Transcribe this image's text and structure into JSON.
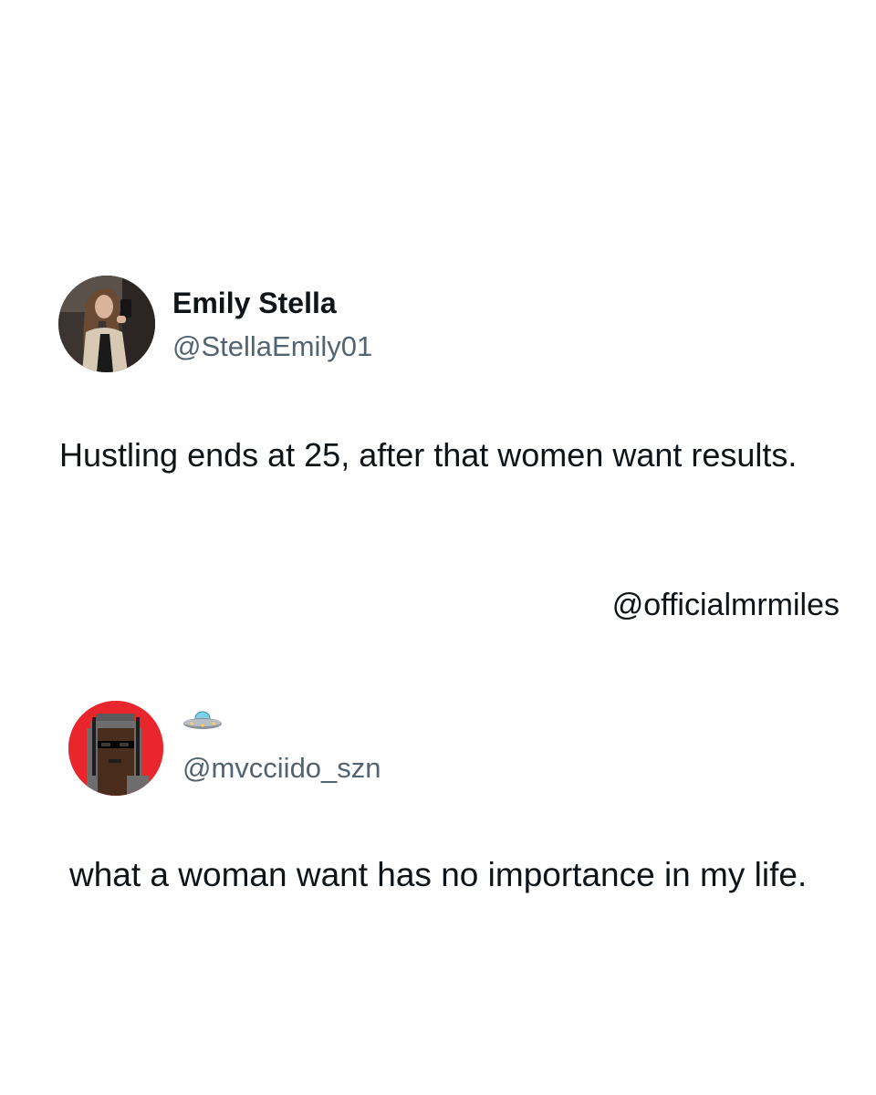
{
  "tweets": [
    {
      "display_name": "Emily Stella",
      "handle": "@StellaEmily01",
      "text": "Hustling ends at 25, after that women want results.",
      "avatar_icon": "profile-photo"
    },
    {
      "display_name_icon": "flying-saucer-emoji",
      "handle": "@mvcciido_szn",
      "text": "what a woman want has no importance in my life.",
      "avatar_icon": "pixel-art-punk-avatar",
      "avatar_bg": "#e8262b"
    }
  ],
  "watermark": "@officialmrmiles",
  "colors": {
    "text": "#0f1419",
    "handle": "#536471",
    "background": "#ffffff"
  }
}
